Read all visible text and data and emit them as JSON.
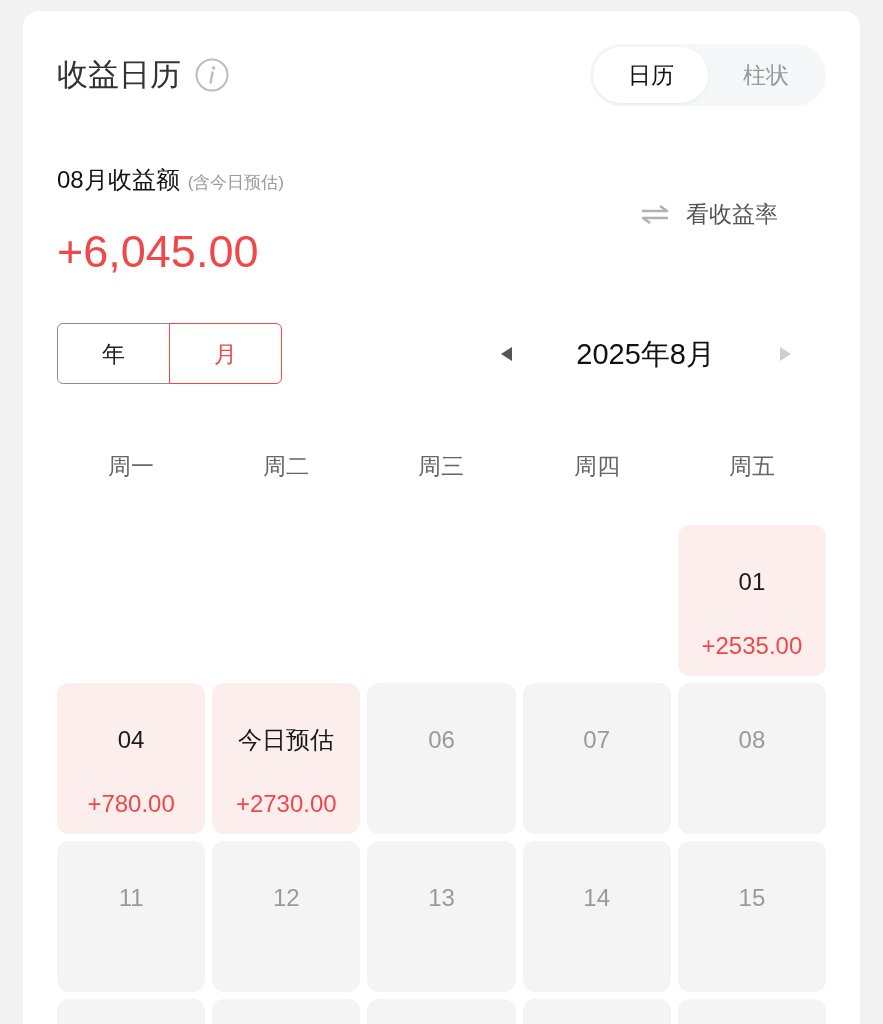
{
  "header": {
    "title": "收益日历",
    "view_tabs": [
      {
        "label": "日历",
        "selected": true
      },
      {
        "label": "柱状",
        "selected": false
      }
    ]
  },
  "summary": {
    "label": "08月收益额",
    "note": "(含今日预估)",
    "amount": "+6,045.00",
    "switch_link": "看收益率"
  },
  "period": {
    "modes": [
      {
        "label": "年",
        "selected": false
      },
      {
        "label": "月",
        "selected": true
      }
    ],
    "prev_button": {
      "disabled": false
    },
    "month": "2025年8月",
    "next_button": {
      "disabled": true
    }
  },
  "calendar": {
    "weekdays": [
      "周一",
      "周二",
      "周三",
      "周四",
      "周五"
    ],
    "weeks": [
      [
        {
          "kind": "blank"
        },
        {
          "kind": "blank"
        },
        {
          "kind": "blank"
        },
        {
          "kind": "blank"
        },
        {
          "kind": "earning",
          "day": "01",
          "amount": "+2535.00"
        }
      ],
      [
        {
          "kind": "earning",
          "day": "04",
          "amount": "+780.00"
        },
        {
          "kind": "earning",
          "day": "今日预估",
          "amount": "+2730.00"
        },
        {
          "kind": "day",
          "day": "06"
        },
        {
          "kind": "day",
          "day": "07"
        },
        {
          "kind": "day",
          "day": "08"
        }
      ],
      [
        {
          "kind": "day",
          "day": "11"
        },
        {
          "kind": "day",
          "day": "12"
        },
        {
          "kind": "day",
          "day": "13"
        },
        {
          "kind": "day",
          "day": "14"
        },
        {
          "kind": "day",
          "day": "15"
        }
      ],
      [
        {
          "kind": "day"
        },
        {
          "kind": "day"
        },
        {
          "kind": "day"
        },
        {
          "kind": "day"
        },
        {
          "kind": "day"
        }
      ]
    ]
  }
}
